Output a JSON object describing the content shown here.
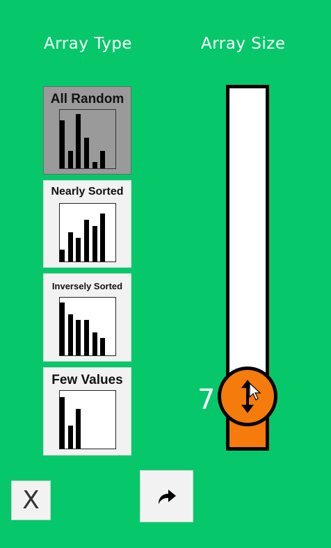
{
  "headings": {
    "array_type": "Array Type",
    "array_size": "Array Size"
  },
  "array_types": [
    {
      "label": "All Random",
      "selected": true,
      "bars": [
        0.82,
        0.3,
        0.93,
        0.52,
        0.11,
        0.3
      ]
    },
    {
      "label": "Nearly Sorted",
      "selected": false,
      "bars": [
        0.2,
        0.51,
        0.41,
        0.72,
        0.62,
        0.83
      ]
    },
    {
      "label": "Inversely Sorted",
      "selected": false,
      "bars": [
        0.91,
        0.71,
        0.61,
        0.61,
        0.4,
        0.3
      ]
    },
    {
      "label": "Few Values",
      "selected": false,
      "bars": [
        0.89,
        0.4,
        0.69
      ]
    }
  ],
  "array_size": {
    "value": "7",
    "level": 0.08
  },
  "controls": {
    "close_label": "X",
    "next_icon": "redo-arrow-icon",
    "knob_icon": "vertical-arrows-icon"
  },
  "colors": {
    "background": "#06c86a",
    "accent": "#f47b0c"
  }
}
